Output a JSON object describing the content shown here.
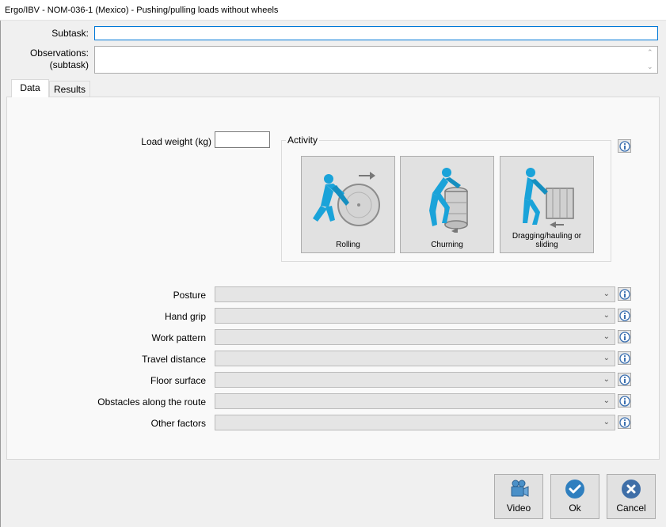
{
  "window": {
    "title": "Ergo/IBV - NOM-036-1 (Mexico) - Pushing/pulling loads without wheels"
  },
  "form": {
    "subtask_label": "Subtask:",
    "subtask_value": "",
    "observations_label_1": "Observations:",
    "observations_label_2": "(subtask)",
    "observations_value": ""
  },
  "tabs": [
    {
      "label": "Data"
    },
    {
      "label": "Results"
    }
  ],
  "data": {
    "load_weight_label": "Load weight (kg)",
    "load_weight_value": "",
    "activity_legend": "Activity",
    "activities": [
      {
        "label": "Rolling",
        "icon": "rolling-worker-icon"
      },
      {
        "label": "Churning",
        "icon": "churning-worker-icon"
      },
      {
        "label": "Dragging/hauling or sliding",
        "icon": "dragging-worker-icon"
      }
    ],
    "fields": [
      {
        "label": "Posture",
        "value": ""
      },
      {
        "label": "Hand grip",
        "value": ""
      },
      {
        "label": "Work pattern",
        "value": ""
      },
      {
        "label": "Travel distance",
        "value": ""
      },
      {
        "label": "Floor surface",
        "value": ""
      },
      {
        "label": "Obstacles along the route",
        "value": ""
      },
      {
        "label": "Other factors",
        "value": ""
      }
    ]
  },
  "buttons": {
    "video": "Video",
    "ok": "Ok",
    "cancel": "Cancel"
  },
  "colors": {
    "accent": "#0078d7",
    "figure": "#1aa3d9",
    "ok": "#2f7fbf",
    "cancel": "#3f6fa8"
  }
}
